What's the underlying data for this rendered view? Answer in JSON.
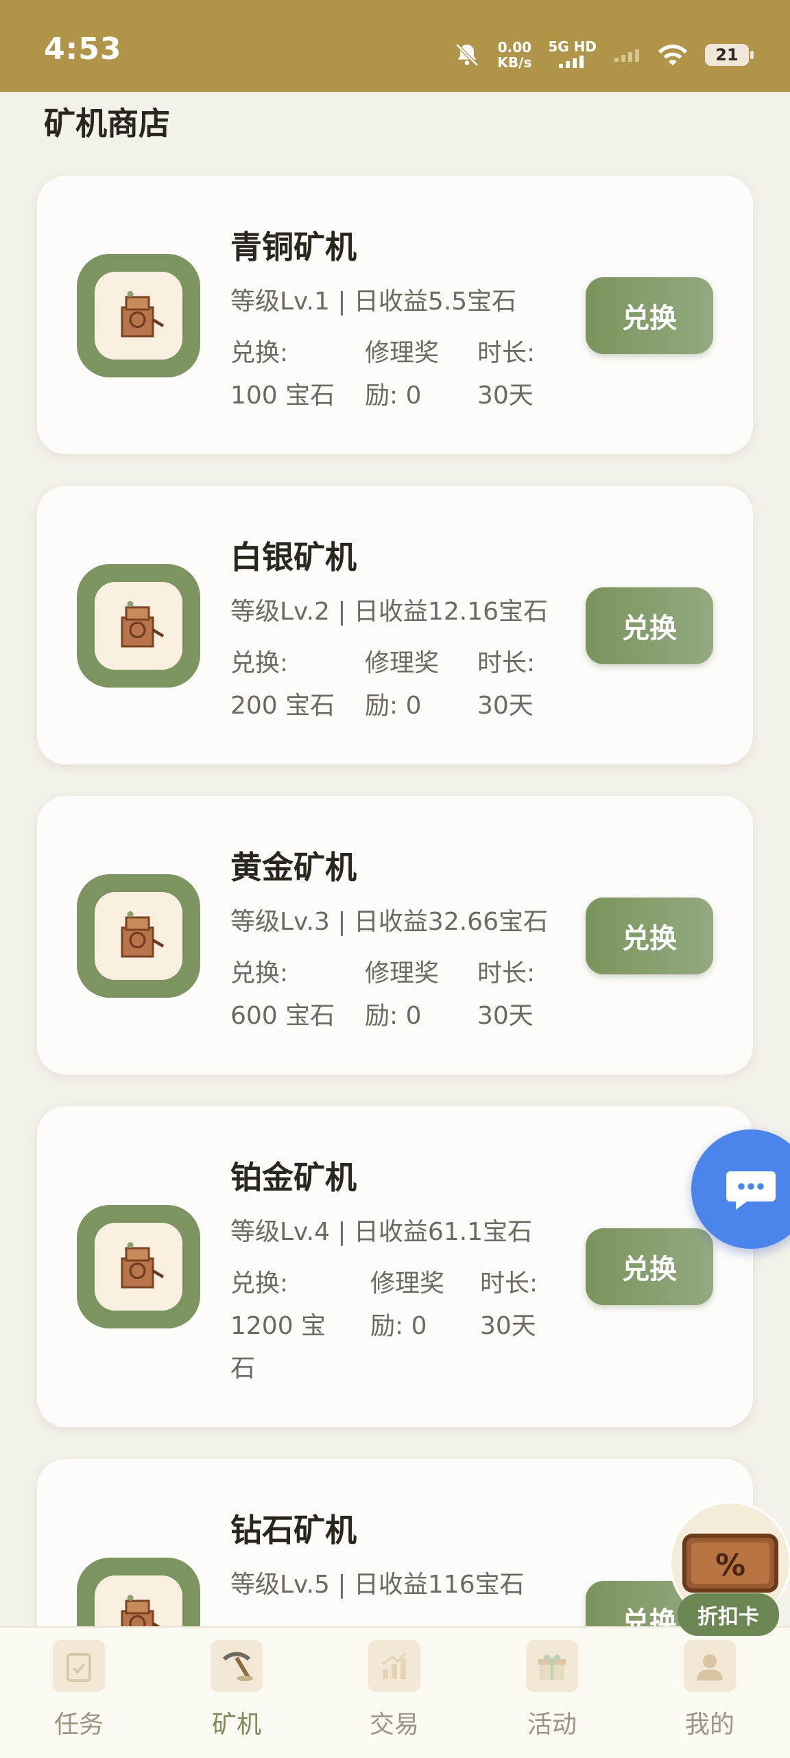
{
  "status_bar": {
    "time": "4:53",
    "net_speed_value": "0.00",
    "net_speed_unit": "KB/s",
    "network": "5G HD",
    "battery": "21"
  },
  "page_title": "矿机商店",
  "labels": {
    "exchange_cost": "兑换:",
    "repair_reward": "修理奖",
    "duration": "时长:",
    "button": "兑换"
  },
  "miners": [
    {
      "name": "青铜矿机",
      "subtitle": "等级Lv.1 | 日收益5.5宝石",
      "cost": "100 宝石",
      "reward": "励: 0",
      "duration": "30天"
    },
    {
      "name": "白银矿机",
      "subtitle": "等级Lv.2 | 日收益12.16宝石",
      "cost": "200 宝石",
      "reward": "励: 0",
      "duration": "30天"
    },
    {
      "name": "黄金矿机",
      "subtitle": "等级Lv.3 | 日收益32.66宝石",
      "cost": "600 宝石",
      "reward": "励: 0",
      "duration": "30天"
    },
    {
      "name": "铂金矿机",
      "subtitle": "等级Lv.4 | 日收益61.1宝石",
      "cost_line1": "1200 宝",
      "cost_line2": "石",
      "reward": "励: 0",
      "duration": "30天"
    },
    {
      "name": "钻石矿机",
      "subtitle": "等级Lv.5 | 日收益116宝石"
    }
  ],
  "discount_label": "折扣卡",
  "tabs": [
    {
      "label": "任务",
      "icon": "clipboard-icon"
    },
    {
      "label": "矿机",
      "icon": "pickaxe-icon",
      "active": true
    },
    {
      "label": "交易",
      "icon": "chart-icon"
    },
    {
      "label": "活动",
      "icon": "gift-icon"
    },
    {
      "label": "我的",
      "icon": "user-icon"
    }
  ],
  "colors": {
    "status_bar": "#b0944a",
    "accent_green": "#7a945c",
    "chat_blue": "#4b85ec",
    "background": "#f4f1ea"
  }
}
